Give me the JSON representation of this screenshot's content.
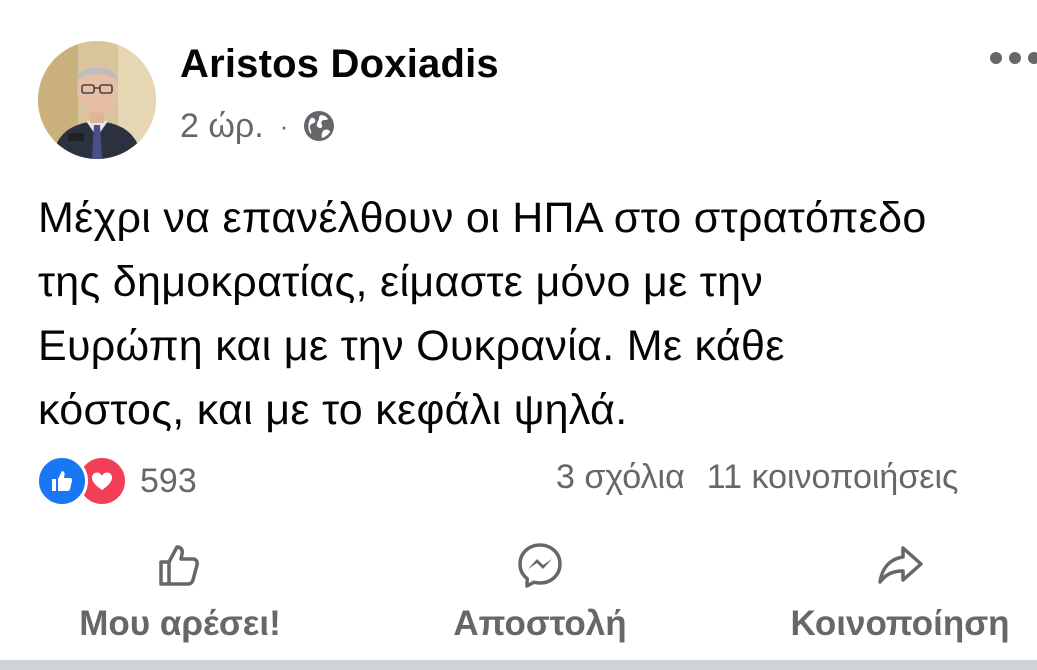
{
  "post": {
    "author": "Aristos Doxiadis",
    "time": "2 ώρ.",
    "separator": "·",
    "privacy_icon": "globe-icon",
    "more_icon": "more-horizontal-icon",
    "text_lines": [
      "Μέχρι να επανέλθουν οι ΗΠΑ στο στρατόπεδο",
      "της δημοκρατίας, είμαστε μόνο με την",
      "Ευρώπη και με την Ουκρανία. Με κάθε",
      "κόστος, και με το κεφάλι ψηλά."
    ]
  },
  "reactions": {
    "icons": [
      "like-reaction-icon",
      "love-reaction-icon"
    ],
    "count": "593",
    "comments": "3 σχόλια",
    "shares": "11 κοινοποιήσεις"
  },
  "actions": {
    "like": {
      "label": "Μου αρέσει!",
      "icon": "thumbs-up-icon"
    },
    "send": {
      "label": "Αποστολή",
      "icon": "messenger-icon"
    },
    "share": {
      "label": "Κοινοποίηση",
      "icon": "share-arrow-icon"
    }
  },
  "colors": {
    "text_primary": "#050505",
    "text_secondary": "#65676b",
    "like_blue": "#1877f2",
    "love_red": "#f33e58"
  }
}
